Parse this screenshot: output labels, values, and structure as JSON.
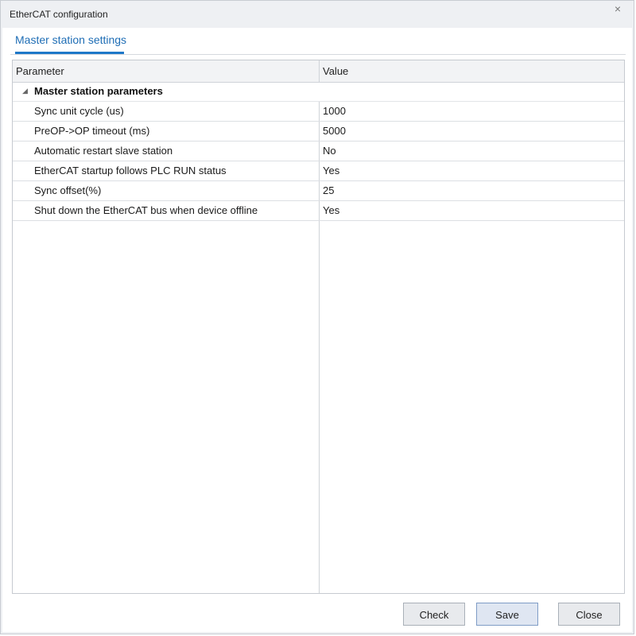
{
  "window": {
    "title": "EtherCAT configuration",
    "close_glyph": "×"
  },
  "tabs": [
    {
      "label": "Master station settings",
      "active": true
    }
  ],
  "grid": {
    "columns": {
      "parameter": "Parameter",
      "value": "Value"
    },
    "group": {
      "label": "Master station parameters",
      "expanded": true,
      "arrow_glyph": "◢"
    },
    "rows": [
      {
        "parameter": "Sync unit cycle (us)",
        "value": "1000"
      },
      {
        "parameter": "PreOP->OP timeout (ms)",
        "value": "5000"
      },
      {
        "parameter": "Automatic restart slave station",
        "value": "No"
      },
      {
        "parameter": "EtherCAT startup follows PLC RUN status",
        "value": "Yes"
      },
      {
        "parameter": "Sync offset(%)",
        "value": "25"
      },
      {
        "parameter": "Shut down the EtherCAT bus when device offline",
        "value": "Yes"
      }
    ]
  },
  "buttons": {
    "check": "Check",
    "save": "Save",
    "close": "Close"
  },
  "colors": {
    "accent": "#1e78c8",
    "tab_text": "#1e6db5",
    "window_bg": "#eef0f3"
  }
}
